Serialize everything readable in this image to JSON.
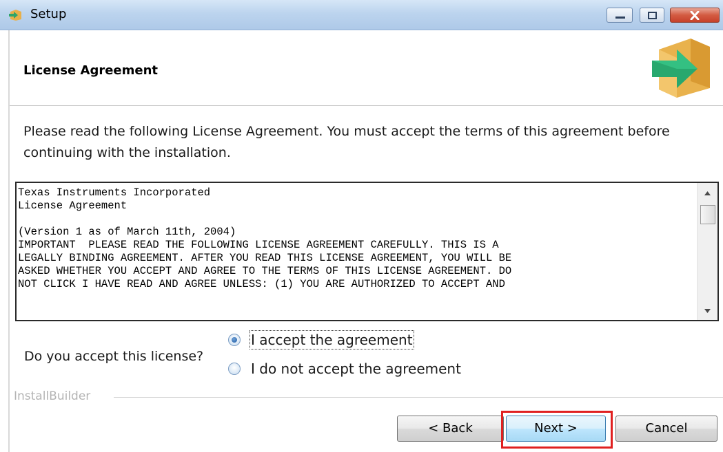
{
  "window": {
    "title": "Setup",
    "icon": "setup-box-arrow-icon",
    "controls": [
      "minimize-icon",
      "maximize-icon",
      "close-icon"
    ]
  },
  "header": {
    "heading": "License Agreement",
    "icon": "box-arrow-icon"
  },
  "intro_text": "Please read the following License Agreement. You must accept the terms of this agreement before continuing with the installation.",
  "license_text_lines": [
    "Texas Instruments Incorporated",
    "License Agreement",
    "",
    "(Version 1 as of March 11th, 2004)",
    "IMPORTANT  PLEASE READ THE FOLLOWING LICENSE AGREEMENT CAREFULLY. THIS IS A",
    "LEGALLY BINDING AGREEMENT. AFTER YOU READ THIS LICENSE AGREEMENT, YOU WILL BE",
    "ASKED WHETHER YOU ACCEPT AND AGREE TO THE TERMS OF THIS LICENSE AGREEMENT. DO",
    "NOT CLICK I HAVE READ AND AGREE UNLESS: (1) YOU ARE AUTHORIZED TO ACCEPT AND"
  ],
  "question": "Do you accept this license?",
  "options": {
    "accept": "I accept the agreement",
    "decline": "I do not accept the agreement",
    "selected": "accept"
  },
  "footer": {
    "brand": "InstallBuilder"
  },
  "buttons": {
    "back": "< Back",
    "next": "Next >",
    "cancel": "Cancel"
  },
  "colors": {
    "highlight": "#e02020",
    "titlebar": "#bcd4ee",
    "close_button": "#c7412b"
  }
}
